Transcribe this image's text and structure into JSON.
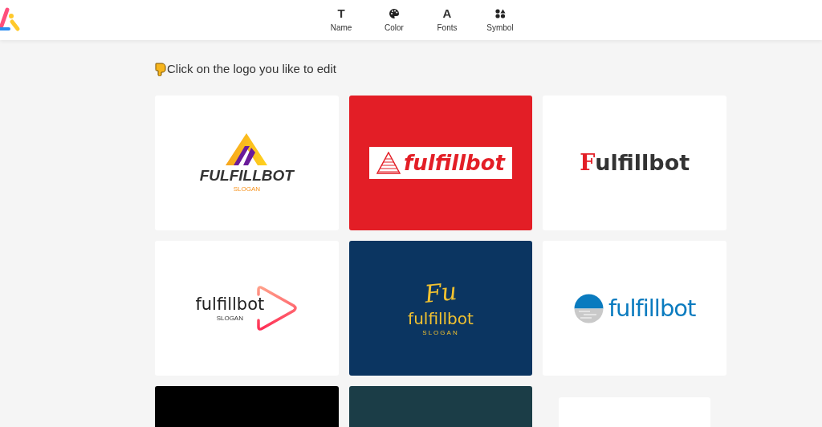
{
  "nav": [
    {
      "kind": "glyph",
      "icon": "T",
      "label": "Name"
    },
    {
      "kind": "palette",
      "label": "Color"
    },
    {
      "kind": "glyph",
      "icon": "A",
      "label": "Fonts"
    },
    {
      "kind": "shapes",
      "label": "Symbol"
    }
  ],
  "heading": "Click on the logo you like to edit",
  "cards": [
    {
      "kind": "peak",
      "color": "#ffffff",
      "name": "FULFILLBOT",
      "slogan": "SLOGAN"
    },
    {
      "kind": "framed",
      "color": "#e31e26",
      "name": "fulfillbot"
    },
    {
      "kind": "initial",
      "color": "#ffffff",
      "name": "Fulfillbot"
    },
    {
      "kind": "play",
      "color": "#ffffff",
      "name": "fulfillbot",
      "slogan": "SLOGAN"
    },
    {
      "kind": "signature",
      "color": "#0b3561",
      "monogram": "Fu",
      "name": "fulfillbot",
      "slogan": "SLOGAN"
    },
    {
      "kind": "globe",
      "color": "#ffffff",
      "name": "fulfillbot"
    },
    {
      "kind": "blank",
      "color": "#000000"
    },
    {
      "kind": "blank",
      "color": "#1b3d47"
    },
    {
      "kind": "loading",
      "color": "#ffffff"
    }
  ]
}
